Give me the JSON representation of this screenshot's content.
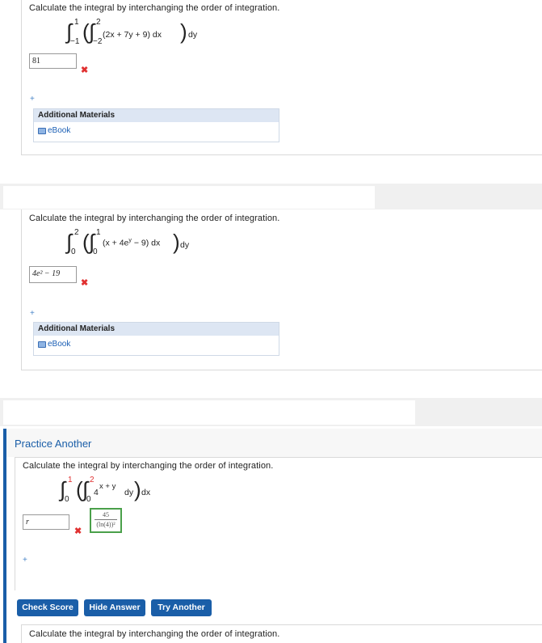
{
  "q1": {
    "prompt": "Calculate the integral by interchanging the order of integration.",
    "outer_upper": "1",
    "outer_lower": "−1",
    "inner_upper": "2",
    "inner_lower": "−2",
    "integrand": "(2x + 7y + 9) dx",
    "outer_diff": "dy",
    "answer": "81",
    "ebook": "eBook",
    "addl_title": "Additional Materials"
  },
  "q2": {
    "prompt": "Calculate the integral by interchanging the order of integration.",
    "outer_upper": "2",
    "outer_lower": "0",
    "inner_upper": "1",
    "inner_lower": "0",
    "integrand_a": "(x + 4e",
    "integrand_sup": "y",
    "integrand_b": " − 9) dx",
    "outer_diff": "dy",
    "answer": "4e² − 19",
    "ebook": "eBook",
    "addl_title": "Additional Materials"
  },
  "practice": {
    "title": "Practice Another",
    "prompt": "Calculate the integral by interchanging the order of integration.",
    "outer_upper": "1",
    "outer_lower": "0",
    "inner_upper": "2",
    "inner_lower": "0",
    "base": "4",
    "exponent": "x + y",
    "inner_diff": "dy",
    "outer_diff": "dx",
    "answer": "r",
    "correct_num": "45",
    "correct_den": "(ln(4))²",
    "buttons": {
      "check": "Check Score",
      "hide": "Hide Answer",
      "try": "Try Another"
    },
    "bottom_prompt": "Calculate the integral by interchanging the order of integration."
  },
  "icons": {
    "incorrect": "x-mark-icon",
    "expand": "plus-icon",
    "ebook": "book-icon"
  },
  "colors": {
    "accent": "#1a5ea8",
    "incorrect": "#e03030",
    "correct_border": "#4aa04a",
    "left_bar": "#1a5ea8"
  }
}
